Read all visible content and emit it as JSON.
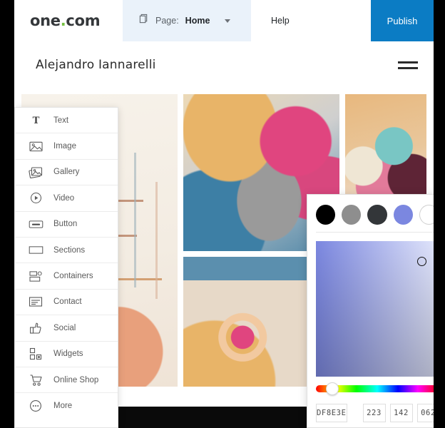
{
  "toolbar": {
    "brand_name": "one",
    "brand_dot": ".",
    "brand_suffix": "com",
    "pages_icon": "pages-copy-icon",
    "page_label": "Page:",
    "page_value": "Home",
    "page_dropdown_icon": "chevron-down-icon",
    "help_label": "Help",
    "publish_label": "Publish",
    "publish_color": "#0b7cc4",
    "page_select_bg": "#eaf2fa"
  },
  "site": {
    "title": "Alejandro Iannarelli",
    "menu_icon": "hamburger-menu-icon"
  },
  "element_panel": {
    "items": [
      {
        "label": "Text",
        "icon": "text-t-icon"
      },
      {
        "label": "Image",
        "icon": "image-icon"
      },
      {
        "label": "Gallery",
        "icon": "gallery-stack-icon"
      },
      {
        "label": "Video",
        "icon": "video-play-icon"
      },
      {
        "label": "Button",
        "icon": "button-icon"
      },
      {
        "label": "Sections",
        "icon": "sections-rectangle-icon"
      },
      {
        "label": "Containers",
        "icon": "containers-icon"
      },
      {
        "label": "Contact",
        "icon": "contact-form-icon"
      },
      {
        "label": "Social",
        "icon": "thumbs-up-icon"
      },
      {
        "label": "Widgets",
        "icon": "widgets-blocks-icon"
      },
      {
        "label": "Online Shop",
        "icon": "shopping-cart-icon"
      },
      {
        "label": "More",
        "icon": "more-ellipsis-icon"
      }
    ]
  },
  "color_picker": {
    "swatches": [
      {
        "name": "black",
        "color": "#000000"
      },
      {
        "name": "gray",
        "color": "#8e8e8e"
      },
      {
        "name": "dark-gray",
        "color": "#333639"
      },
      {
        "name": "periwinkle",
        "color": "#7b87e0"
      },
      {
        "name": "white",
        "color": "#ffffff"
      }
    ],
    "hex_value": "DF8E3E",
    "rgb": {
      "r": "223",
      "g": "142",
      "b": "062"
    },
    "selected_color": "#DF8E3E"
  },
  "gallery": {
    "tiles": [
      {
        "name": "abstract-spheres-artwork"
      },
      {
        "name": "painted-face-portrait-artwork"
      },
      {
        "name": "abstract-arcs-artwork"
      },
      {
        "name": "teal-creature-artwork"
      },
      {
        "name": "dark-swirl-artwork"
      }
    ]
  }
}
